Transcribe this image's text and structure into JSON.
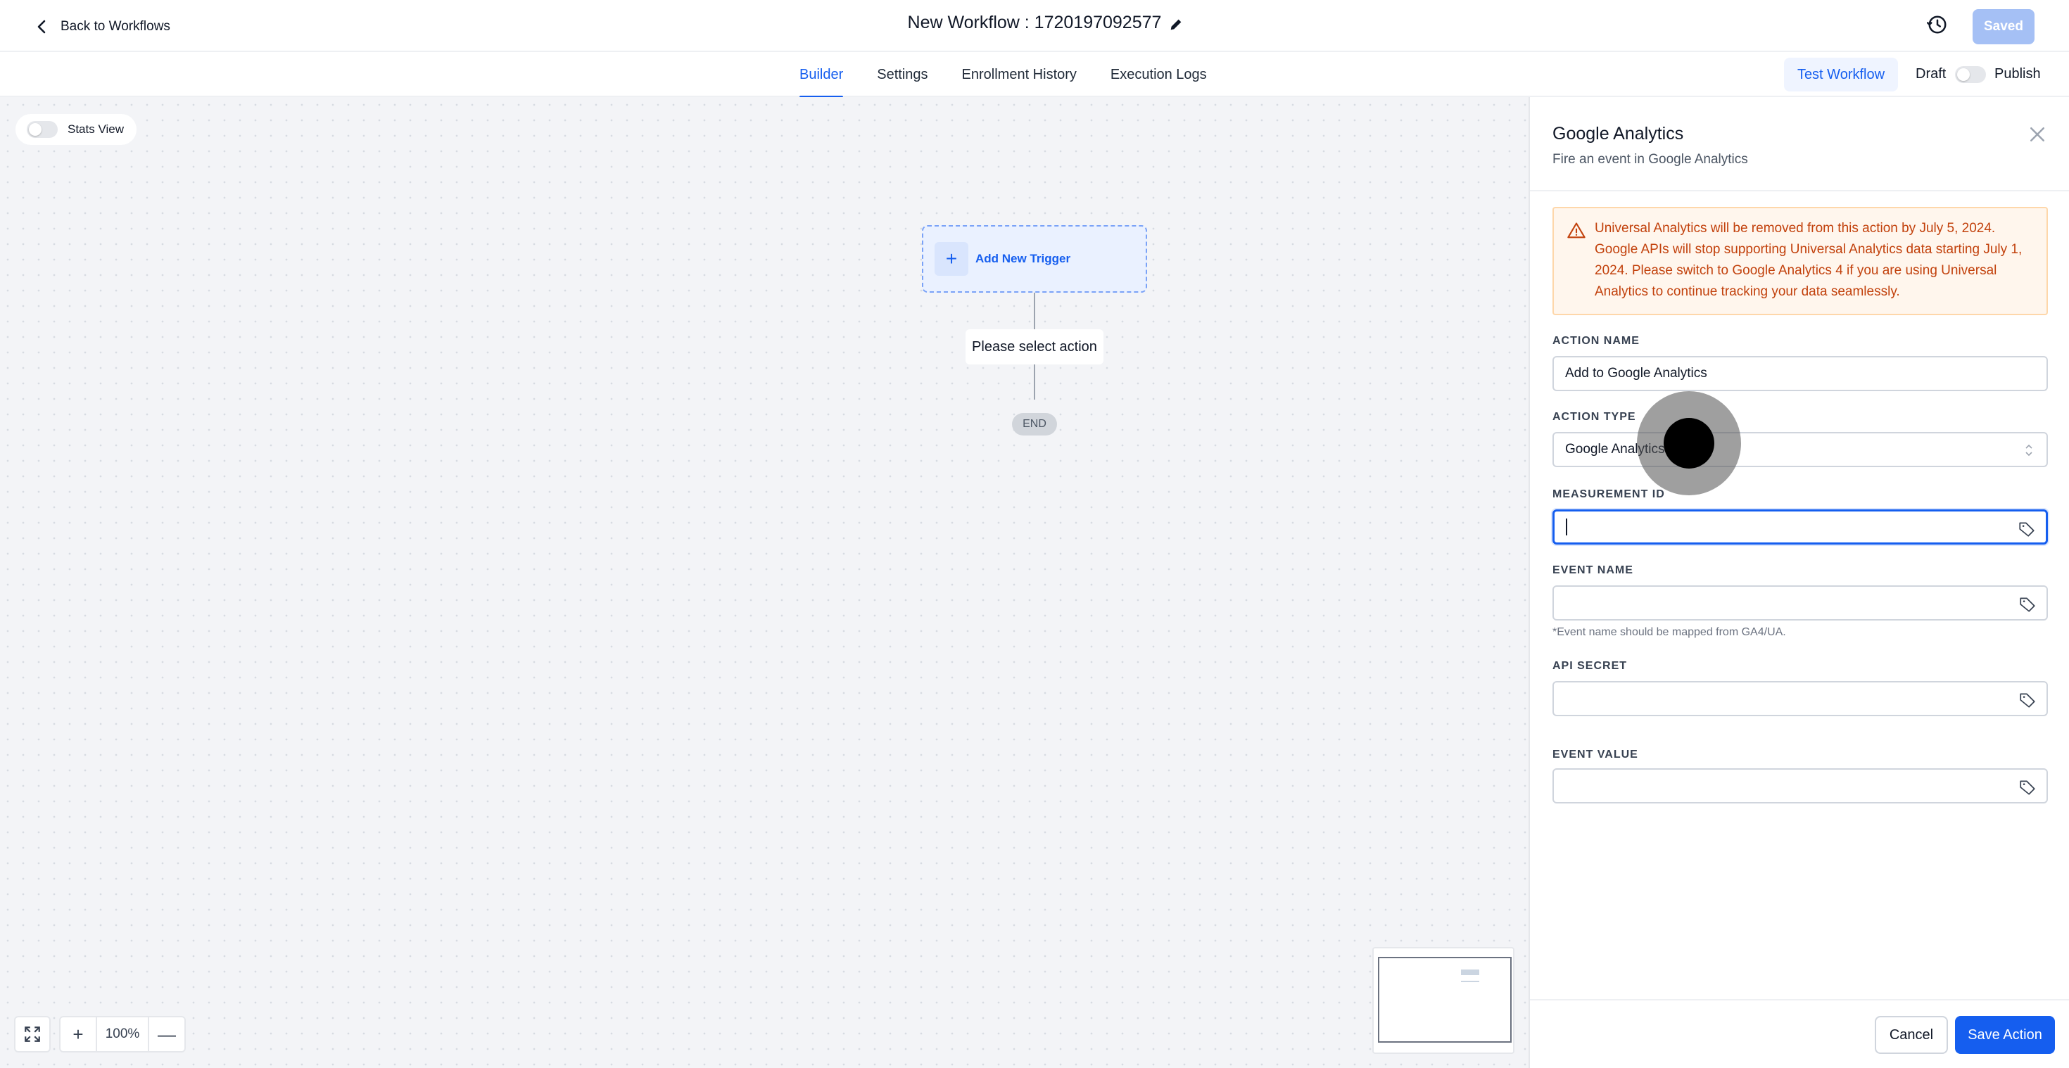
{
  "header": {
    "back_label": "Back to Workflows",
    "workflow_title": "New Workflow : 1720197092577",
    "saved_label": "Saved"
  },
  "subnav": {
    "tabs": [
      {
        "label": "Builder",
        "active": true
      },
      {
        "label": "Settings",
        "active": false
      },
      {
        "label": "Enrollment History",
        "active": false
      },
      {
        "label": "Execution Logs",
        "active": false
      }
    ],
    "test_workflow_label": "Test Workflow",
    "draft_label": "Draft",
    "publish_label": "Publish"
  },
  "canvas": {
    "stats_view_label": "Stats View",
    "trigger_label": "Add New Trigger",
    "trigger_plus": "+",
    "action_placeholder": "Please select action",
    "end_label": "END",
    "zoom_level": "100%",
    "zoom_in_symbol": "+",
    "zoom_out_symbol": "—"
  },
  "panel": {
    "title": "Google Analytics",
    "subtitle": "Fire an event in Google Analytics",
    "warning": "Universal Analytics will be removed from this action by July 5, 2024. Google APIs will stop supporting Universal Analytics data starting July 1, 2024. Please switch to Google Analytics 4 if you are using Universal Analytics to continue tracking your data seamlessly.",
    "fields": {
      "action_name_label": "ACTION NAME",
      "action_name_value": "Add to Google Analytics",
      "action_type_label": "ACTION TYPE",
      "action_type_value": "Google Analytics",
      "measurement_id_label": "MEASUREMENT ID",
      "measurement_id_value": "",
      "event_name_label": "EVENT NAME",
      "event_name_value": "",
      "event_name_hint": "*Event name should be mapped from GA4/UA.",
      "api_secret_label": "API SECRET",
      "api_secret_value": "",
      "event_value_label": "EVENT VALUE",
      "event_value_value": ""
    },
    "cancel_label": "Cancel",
    "save_label": "Save Action"
  },
  "colors": {
    "accent": "#155eef",
    "warning_text": "#c2410c",
    "warning_bg": "#fff6ed",
    "saved_button": "#a5c0f5"
  },
  "icons": [
    "chevron-left-icon",
    "pencil-icon",
    "history-icon",
    "close-icon",
    "warning-icon",
    "tag-icon",
    "chevron-updown-icon",
    "expand-icon",
    "plus-icon",
    "minus-icon"
  ]
}
